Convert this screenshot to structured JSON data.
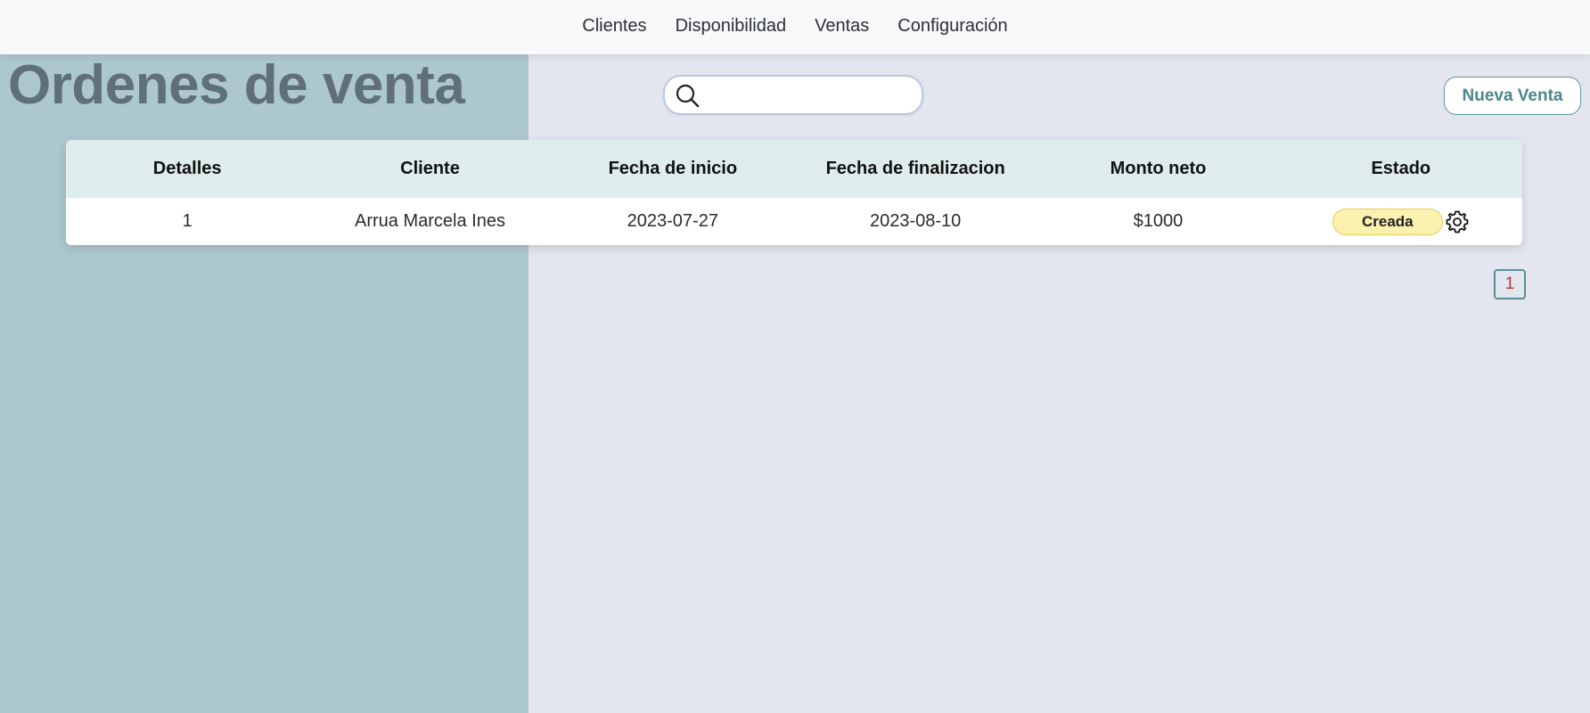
{
  "nav": {
    "items": [
      {
        "label": "Clientes"
      },
      {
        "label": "Disponibilidad"
      },
      {
        "label": "Ventas"
      },
      {
        "label": "Configuración"
      }
    ]
  },
  "page": {
    "title": "Ordenes de venta"
  },
  "search": {
    "value": "",
    "placeholder": "",
    "icon": "search-icon"
  },
  "actions": {
    "new_sale_label": "Nueva Venta"
  },
  "table": {
    "headers": {
      "details": "Detalles",
      "client": "Cliente",
      "start_date": "Fecha de inicio",
      "end_date": "Fecha de finalizacion",
      "net_amount": "Monto neto",
      "status": "Estado"
    },
    "rows": [
      {
        "details": "1",
        "client": "Arrua Marcela Ines",
        "start_date": "2023-07-27",
        "end_date": "2023-08-10",
        "net_amount": "$1000",
        "status": "Creada",
        "action_icon": "gear-icon"
      }
    ]
  },
  "pagination": {
    "current_page": "1"
  },
  "colors": {
    "left_panel": "#adc7ce",
    "background": "#e3e6ee",
    "table_header": "#dfecec",
    "status_created_bg": "#fbf2b0",
    "accent": "#4e8689"
  }
}
